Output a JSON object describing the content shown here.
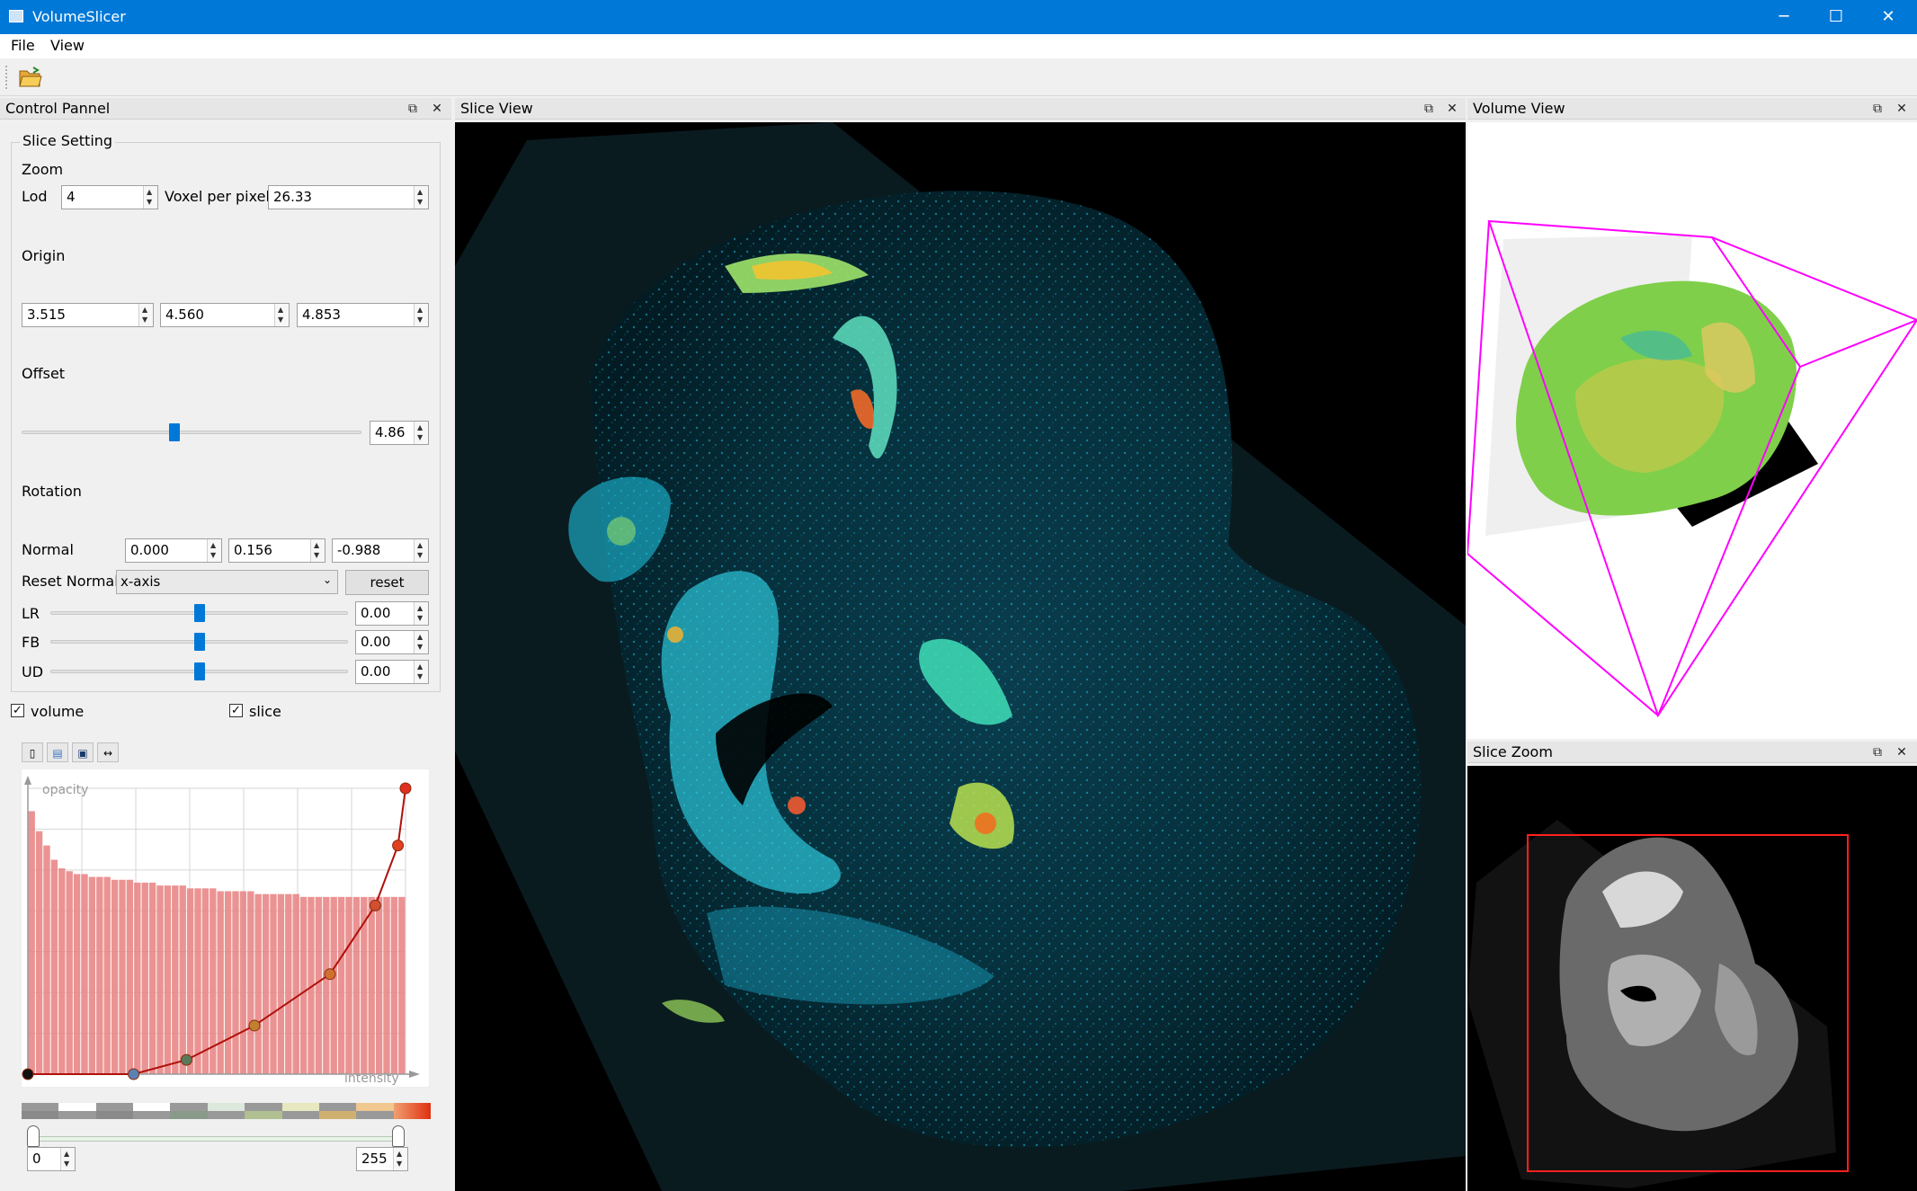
{
  "app": {
    "title": "VolumeSlicer",
    "menu": [
      "File",
      "View"
    ],
    "window_buttons": {
      "minimize": "─",
      "maximize": "☐",
      "close": "✕"
    }
  },
  "control_panel": {
    "title": "Control Pannel",
    "group_title": "Slice Setting",
    "zoom_label": "Zoom",
    "lod_label": "Lod",
    "lod_value": "4",
    "voxel_label": "Voxel per pixel",
    "voxel_value": "26.33",
    "origin_label": "Origin",
    "origin": [
      "3.515",
      "4.560",
      "4.853"
    ],
    "offset_label": "Offset",
    "offset_value": "4.86",
    "offset_level": 0.45,
    "rotation_label": "Rotation",
    "normal_label": "Normal",
    "normal": [
      "0.000",
      "0.156",
      "-0.988"
    ],
    "reset_normal_label": "Reset Normal",
    "reset_normal_selected": "x-axis",
    "reset_button": "reset",
    "lr_label": "LR",
    "lr_value": "0.00",
    "fb_label": "FB",
    "fb_value": "0.00",
    "ud_label": "UD",
    "ud_value": "0.00",
    "volume_checkbox": "volume",
    "slice_checkbox": "slice",
    "tf": {
      "y_label": "opacity",
      "x_label": "intensity",
      "points": [
        [
          0,
          0
        ],
        [
          0.28,
          0
        ],
        [
          0.42,
          0.05
        ],
        [
          0.6,
          0.17
        ],
        [
          0.8,
          0.35
        ],
        [
          0.92,
          0.59
        ],
        [
          0.98,
          0.8
        ],
        [
          1.0,
          1.0
        ]
      ],
      "histogram": [
        0.92,
        0.85,
        0.8,
        0.75,
        0.72,
        0.71,
        0.7,
        0.7,
        0.69,
        0.69,
        0.69,
        0.68,
        0.68,
        0.68,
        0.67,
        0.67,
        0.67,
        0.66,
        0.66,
        0.66,
        0.66,
        0.65,
        0.65,
        0.65,
        0.65,
        0.64,
        0.64,
        0.64,
        0.64,
        0.64,
        0.63,
        0.63,
        0.63,
        0.63,
        0.63,
        0.63,
        0.62,
        0.62,
        0.62,
        0.62,
        0.62,
        0.62,
        0.62,
        0.62,
        0.62,
        0.62,
        0.62,
        0.62,
        0.62,
        0.62
      ]
    },
    "range_min": "0",
    "range_max": "255"
  },
  "slice_view": {
    "title": "Slice View"
  },
  "volume_view": {
    "title": "Volume View"
  },
  "slice_zoom": {
    "title": "Slice Zoom"
  },
  "colors": {
    "accent": "#0078d7",
    "box_outline": "#ff00ff",
    "tf_curve": "#b0100a",
    "zoom_frame": "#ff2020"
  }
}
